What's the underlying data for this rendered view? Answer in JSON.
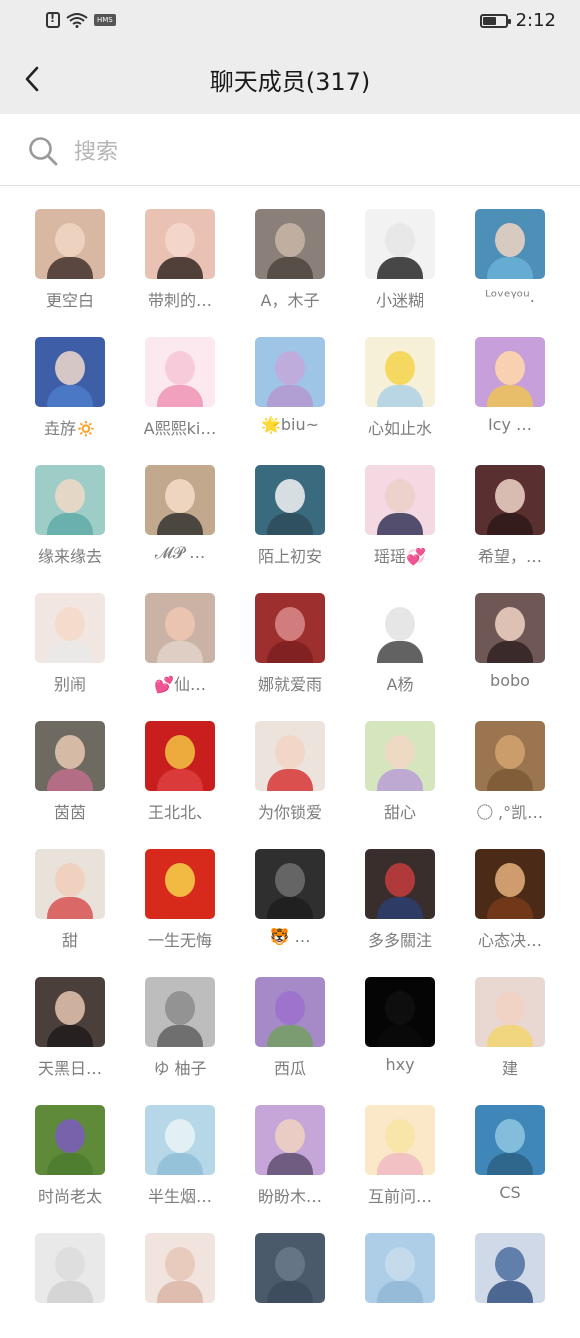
{
  "status_bar": {
    "hms_label": "HMS",
    "time": "2:12",
    "battery_level": 0.6
  },
  "header": {
    "title": "聊天成员(317)",
    "back_icon": "chevron-left-icon"
  },
  "search": {
    "placeholder": "搜索",
    "icon": "search-icon"
  },
  "members": [
    [
      {
        "name": "更空白",
        "bg": "#d9b8a3",
        "face": "#f1d6c5",
        "body": "#3a2a25"
      },
      {
        "name": "带刺的…",
        "bg": "#e9c2b4",
        "face": "#f5d9cc",
        "body": "#2b1e1c"
      },
      {
        "name": "A，木子",
        "bg": "#8a8079",
        "face": "#c9b7a8",
        "body": "#4a413b"
      },
      {
        "name": "小迷糊",
        "bg": "#f2f2f2",
        "face": "#e6e6e6",
        "body": "#1c1c1c"
      },
      {
        "name": "ᴸᵒᵛᵉᵞᵒᵘ.",
        "bg": "#4d8fb7",
        "face": "#f0d5c2",
        "body": "#6db3d8"
      }
    ],
    [
      {
        "name": "垚斿🔅",
        "bg": "#3f5ea8",
        "face": "#f1d9cc",
        "body": "#4e7ecb"
      },
      {
        "name": "A熙熙ki…",
        "bg": "#fbe9ef",
        "face": "#f7c6d6",
        "body": "#ef8fb0"
      },
      {
        "name": "🌟biu~",
        "bg": "#9fc5e6",
        "face": "#c3a7d9",
        "body": "#b593cd"
      },
      {
        "name": "心如止水",
        "bg": "#f6f0d9",
        "face": "#f3d34a",
        "body": "#a9d0e6"
      },
      {
        "name": "Icy …",
        "bg": "#c79fdb",
        "face": "#ffd9a8",
        "body": "#f0c54e"
      }
    ],
    [
      {
        "name": "缘来缘去",
        "bg": "#9ecdc8",
        "face": "#f1d8c6",
        "body": "#5da9a5"
      },
      {
        "name": "𝓜𝓟 …",
        "bg": "#c2a98d",
        "face": "#f6ddc9",
        "body": "#2d2d2d"
      },
      {
        "name": "陌上初安",
        "bg": "#3a6a7d",
        "face": "#f2f2f2",
        "body": "#2c4a58"
      },
      {
        "name": "瑶瑶💞",
        "bg": "#f4d9e3",
        "face": "#e9d0c6",
        "body": "#2b2b4f"
      },
      {
        "name": "希望，…",
        "bg": "#5a2f2f",
        "face": "#f0d5c8",
        "body": "#2a1818"
      }
    ],
    [
      {
        "name": "别闹",
        "bg": "#f1e6e1",
        "face": "#f6d8c7",
        "body": "#eaeaea"
      },
      {
        "name": "💕仙…",
        "bg": "#cab2a4",
        "face": "#f0c5b4",
        "body": "#e4d4ca"
      },
      {
        "name": "娜就爱雨",
        "bg": "#9e2f2f",
        "face": "#d98b8b",
        "body": "#7a1e1e"
      },
      {
        "name": "A杨",
        "bg": "#ffffff",
        "face": "#e2e2e2",
        "body": "#3b3b3b"
      },
      {
        "name": "bobo",
        "bg": "#6e5754",
        "face": "#f1d3c7",
        "body": "#2d1f1e"
      }
    ],
    [
      {
        "name": "茵茵",
        "bg": "#6f6a61",
        "face": "#e8c9b3",
        "body": "#c46e8d"
      },
      {
        "name": "王北北、",
        "bg": "#c81e1e",
        "face": "#f3c343",
        "body": "#e04141"
      },
      {
        "name": "为你锁爱",
        "bg": "#ece3dc",
        "face": "#f3d5c4",
        "body": "#d42b2b"
      },
      {
        "name": "甜心",
        "bg": "#d5e6bf",
        "face": "#f2d7c4",
        "body": "#b79ad6"
      },
      {
        "name": "◌⃝ ,°凯…",
        "bg": "#9a7550",
        "face": "#d2a46e",
        "body": "#7a5733"
      }
    ],
    [
      {
        "name": "甜",
        "bg": "#e8e2db",
        "face": "#f1cdb9",
        "body": "#d64a4a"
      },
      {
        "name": "一生无悔",
        "bg": "#d82a1c",
        "face": "#f7d24a",
        "body": "#d82a1c"
      },
      {
        "name": "🐯 …",
        "bg": "#2f2f2f",
        "face": "#6f6f6f",
        "body": "#1d1d1d"
      },
      {
        "name": "多多關注",
        "bg": "#3a2e2c",
        "face": "#c43c3c",
        "body": "#2a3f74"
      },
      {
        "name": "心态决…",
        "bg": "#4b2a18",
        "face": "#e6b27c",
        "body": "#7b3b1a"
      }
    ],
    [
      {
        "name": "天黑日…",
        "bg": "#4a3f3a",
        "face": "#e5c4b1",
        "body": "#1d1a1a"
      },
      {
        "name": "ゆ 柚子",
        "bg": "#bdbdbd",
        "face": "#8c8c8c",
        "body": "#5b5b5b"
      },
      {
        "name": "西瓜",
        "bg": "#a58ac7",
        "face": "#9b6fcf",
        "body": "#6fa05a"
      },
      {
        "name": "hxy",
        "bg": "#050505",
        "face": "#101010",
        "body": "#0a0a0a"
      },
      {
        "name": "建",
        "bg": "#e9d7d2",
        "face": "#f2d2c4",
        "body": "#f3d66a"
      }
    ],
    [
      {
        "name": "时尚老太",
        "bg": "#5f8a3a",
        "face": "#7a5cc0",
        "body": "#4b7a2f"
      },
      {
        "name": "半生烟…",
        "bg": "#b5d7e8",
        "face": "#eaf3f6",
        "body": "#8fbdd4"
      },
      {
        "name": "盼盼木…",
        "bg": "#c6a6d8",
        "face": "#f0d2c1",
        "body": "#5a4a6a"
      },
      {
        "name": "互前问…",
        "bg": "#fbe8c8",
        "face": "#f7e4a4",
        "body": "#f0b6c3"
      },
      {
        "name": "CS",
        "bg": "#3f87b8",
        "face": "#8fc7e0",
        "body": "#2a5f80"
      }
    ],
    [
      {
        "name": "",
        "bg": "#e9e9e9",
        "face": "#dcdcdc",
        "body": "#cfcfcf"
      },
      {
        "name": "",
        "bg": "#f1e3dd",
        "face": "#e7c7b9",
        "body": "#d9b3a3"
      },
      {
        "name": "",
        "bg": "#4a5a6a",
        "face": "#6a7a8a",
        "body": "#3a4a5a"
      },
      {
        "name": "",
        "bg": "#aecde6",
        "face": "#c9ddec",
        "body": "#8fb6d6"
      },
      {
        "name": "",
        "bg": "#cfd9e8",
        "face": "#4c6ea0",
        "body": "#2a4a7a"
      }
    ]
  ]
}
